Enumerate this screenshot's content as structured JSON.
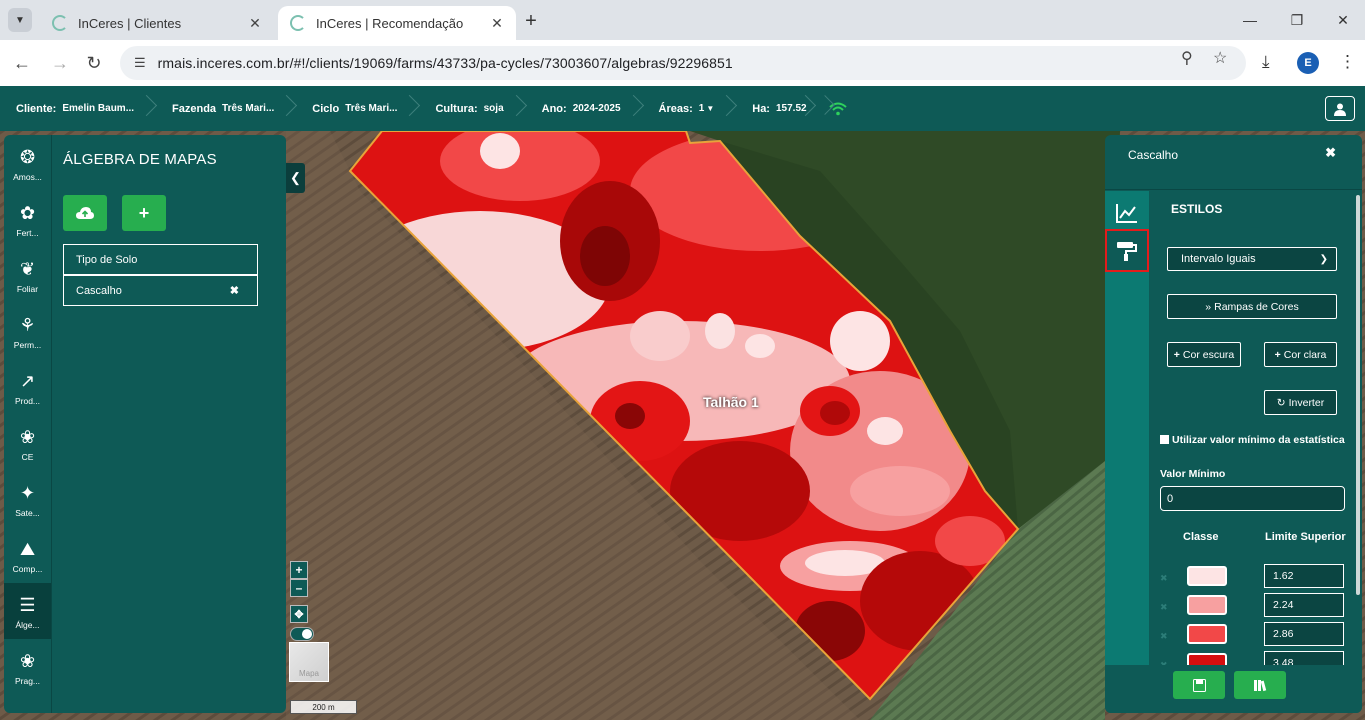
{
  "browser": {
    "tabs": [
      {
        "title": "InCeres | Clientes",
        "active": false
      },
      {
        "title": "InCeres | Recomendação",
        "active": true
      }
    ],
    "url": "rmais.inceres.com.br/#!/clients/19069/farms/43733/pa-cycles/73003607/algebras/92296851",
    "profile_initial": "E"
  },
  "header": {
    "breadcrumbs": [
      {
        "key": "Cliente:",
        "value": "Emelin Baum..."
      },
      {
        "key": "Fazenda",
        "value": "Três Mari..."
      },
      {
        "key": "Ciclo",
        "value": "Três Mari..."
      },
      {
        "key": "Cultura:",
        "value": "soja"
      },
      {
        "key": "Ano:",
        "value": "2024-2025"
      },
      {
        "key": "Áreas:",
        "value": "1"
      },
      {
        "key": "Ha:",
        "value": "157.52"
      }
    ]
  },
  "rail": {
    "items": [
      {
        "label": "Amos...",
        "icon": "sampling-icon"
      },
      {
        "label": "Fert...",
        "icon": "fertilizer-icon"
      },
      {
        "label": "Foliar",
        "icon": "leaf-icon"
      },
      {
        "label": "Perm...",
        "icon": "plant-row-icon"
      },
      {
        "label": "Prod...",
        "icon": "line-chart-icon"
      },
      {
        "label": "CE",
        "icon": "sprout-icon"
      },
      {
        "label": "Sate...",
        "icon": "satellite-icon"
      },
      {
        "label": "Comp...",
        "icon": "terrain-icon"
      },
      {
        "label": "Álge...",
        "icon": "layers-icon",
        "active": true
      },
      {
        "label": "Prag...",
        "icon": "bug-icon"
      }
    ]
  },
  "left_panel": {
    "title": "ÁLGEBRA DE MAPAS",
    "layers": [
      {
        "name": "Tipo de Solo"
      },
      {
        "name": "Cascalho"
      }
    ]
  },
  "map": {
    "field_label": "Talhão 1",
    "basemap_label": "Mapa",
    "scale_label": "200 m"
  },
  "right_panel": {
    "title": "Cascalho",
    "section": "ESTILOS",
    "method_select": "Intervalo Iguais",
    "ramps_button": "Rampas de Cores",
    "dark_button": "Cor escura",
    "light_button": "Cor clara",
    "invert_button": "Inverter",
    "use_min_label": "Utilizar valor mínimo da estatística",
    "min_label": "Valor Mínimo",
    "min_value": "0",
    "col_class": "Classe",
    "col_limit": "Limite Superior",
    "classes": [
      {
        "color": "#fde4e4",
        "limit": "1.62"
      },
      {
        "color": "#f7a0a0",
        "limit": "2.24"
      },
      {
        "color": "#f24848",
        "limit": "2.86"
      },
      {
        "color": "#d40f0f",
        "limit": "3.48"
      }
    ]
  }
}
